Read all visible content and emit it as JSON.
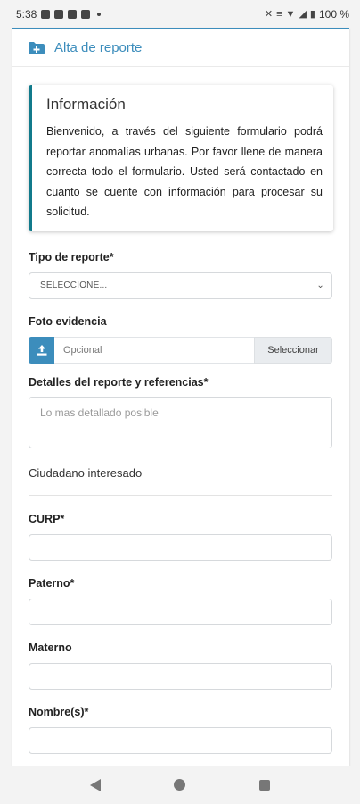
{
  "status_bar": {
    "time": "5:38",
    "battery": "100 %"
  },
  "header": {
    "title": "Alta de reporte",
    "icon": "folder-plus-icon"
  },
  "info": {
    "title": "Información",
    "text": "Bienvenido, a través del siguiente formulario podrá reportar anomalías urbanas. Por favor llene de manera correcta todo el formulario. Usted será contactado en cuanto se cuente con información para procesar su solicitud."
  },
  "form": {
    "tipo_label": "Tipo de reporte*",
    "tipo_value": "SELECCIONE...",
    "foto_label": "Foto evidencia",
    "foto_placeholder": "Opcional",
    "foto_button": "Seleccionar",
    "detalles_label": "Detalles del reporte y referencias*",
    "detalles_placeholder": "Lo mas detallado posible",
    "section_title": "Ciudadano interesado",
    "curp_label": "CURP*",
    "paterno_label": "Paterno*",
    "materno_label": "Materno",
    "nombre_label": "Nombre(s)*"
  },
  "colors": {
    "accent": "#3c8dbc",
    "callout_border": "#117a8b"
  }
}
